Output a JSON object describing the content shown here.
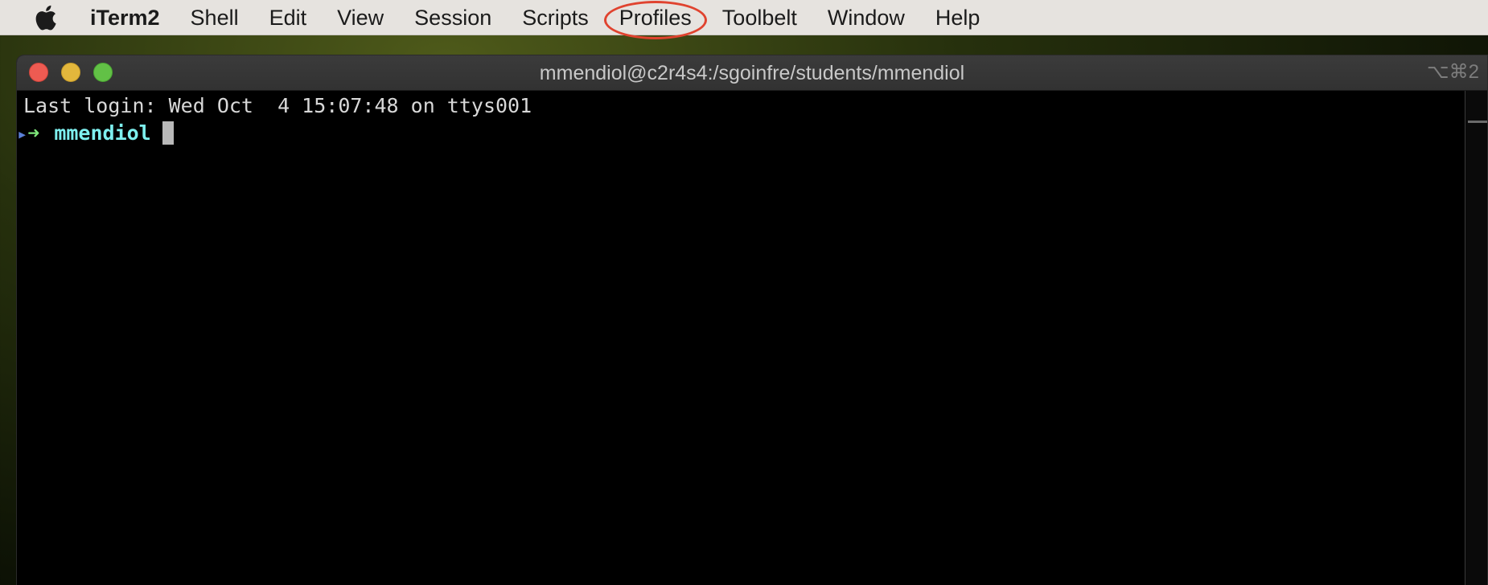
{
  "menubar": {
    "apple_icon": "apple-logo-icon",
    "app_name": "iTerm2",
    "items": [
      "Shell",
      "Edit",
      "View",
      "Session",
      "Scripts",
      "Profiles",
      "Toolbelt",
      "Window",
      "Help"
    ],
    "highlighted_item": "Profiles",
    "highlight_color": "#e0432f"
  },
  "window": {
    "title": "mmendiol@c2r4s4:/sgoinfre/students/mmendiol",
    "shortcut": "⌥⌘2",
    "traffic_colors": {
      "close": "#ee5b52",
      "minimize": "#e3b73c",
      "zoom": "#62c146"
    }
  },
  "terminal": {
    "last_login": "Last login: Wed Oct  4 15:07:48 on ttys001",
    "prompt_marker": "▸",
    "prompt_arrow": "➜",
    "prompt_user": "mmendiol",
    "prompt_user_color": "#7ef0ef",
    "prompt_arrow_color": "#7ee67a"
  }
}
